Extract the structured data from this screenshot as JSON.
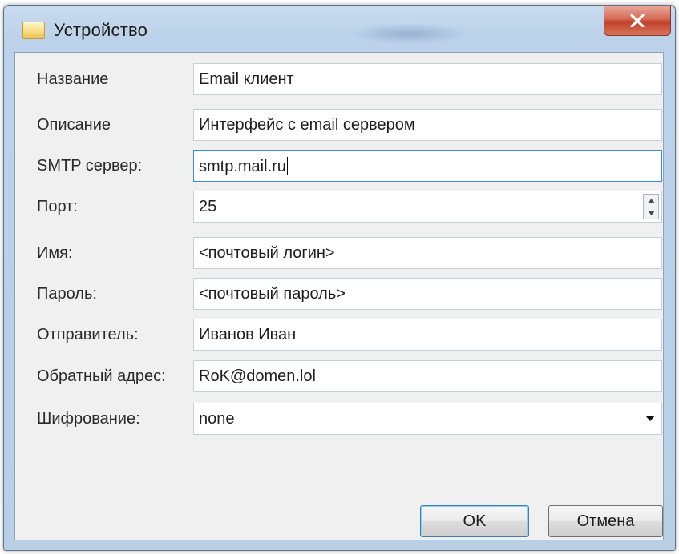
{
  "window": {
    "title": "Устройство",
    "close_symbol": "X",
    "colors": {
      "titlebar": "#bcd2ea",
      "close": "#c2402a",
      "client": "#f0f0f0",
      "focus": "#3d8ed8"
    }
  },
  "form": {
    "fields": [
      {
        "label": "Название",
        "value": "Email клиент"
      },
      {
        "label": "Описание",
        "value": "Интерфейс с email сервером"
      },
      {
        "label": "SMTP сервер:",
        "value": "smtp.mail.ru"
      },
      {
        "label": "Порт:",
        "value": "25"
      },
      {
        "label": "Имя:",
        "value": "<почтовый логин>"
      },
      {
        "label": "Пароль:",
        "value": "<почтовый пароль>"
      },
      {
        "label": "Отправитель:",
        "value": "Иванов Иван"
      },
      {
        "label": "Обратный адрес:",
        "value": "RoK@domen.lol"
      },
      {
        "label": "Шифрование:",
        "value": "none"
      }
    ]
  },
  "buttons": {
    "ok": "OK",
    "cancel": "Отмена"
  },
  "icons": {
    "window": "folder-icon",
    "close": "close-icon",
    "spin_up": "spin-up-icon",
    "spin_down": "spin-down-icon",
    "dropdown": "chevron-down-icon"
  }
}
